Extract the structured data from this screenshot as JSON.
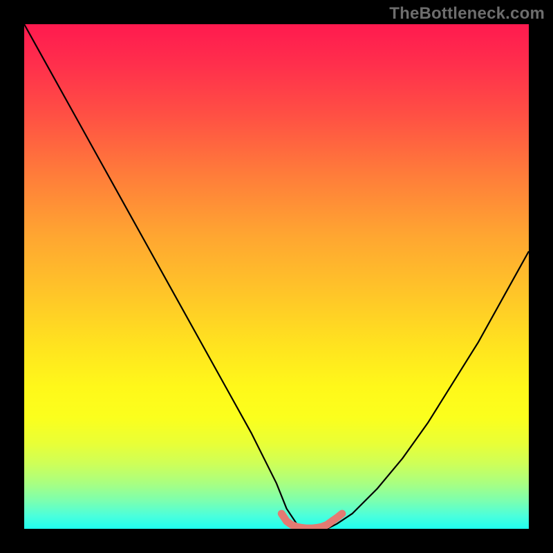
{
  "watermark": "TheBottleneck.com",
  "colors": {
    "frame": "#000000",
    "curve": "#000000",
    "highlight": "#e37a72",
    "gradient_stops": [
      "#ff1a4f",
      "#ff2f4c",
      "#ff5044",
      "#ff7d3a",
      "#ffa631",
      "#ffc728",
      "#ffe41f",
      "#fff81a",
      "#fbff1d",
      "#e9ff36",
      "#cfff57",
      "#a9ff81",
      "#7bffb0",
      "#4affdc",
      "#1fffef"
    ]
  },
  "chart_data": {
    "type": "line",
    "title": "",
    "xlabel": "",
    "ylabel": "",
    "xlim": [
      0,
      100
    ],
    "ylim": [
      0,
      100
    ],
    "annotations": [],
    "series": [
      {
        "name": "curve",
        "x": [
          0,
          5,
          10,
          15,
          20,
          25,
          30,
          35,
          40,
          45,
          50,
          52,
          54,
          56,
          58,
          60,
          62,
          65,
          70,
          75,
          80,
          85,
          90,
          95,
          100
        ],
        "y": [
          100,
          91,
          82,
          73,
          64,
          55,
          46,
          37,
          28,
          19,
          9,
          4,
          1,
          0,
          0,
          0,
          1,
          3,
          8,
          14,
          21,
          29,
          37,
          46,
          55
        ]
      },
      {
        "name": "floor-highlight",
        "x": [
          51,
          52,
          53,
          54,
          55,
          56,
          57,
          58,
          59,
          60,
          61,
          62,
          63
        ],
        "y": [
          3,
          1.5,
          0.8,
          0.4,
          0.2,
          0.1,
          0.1,
          0.2,
          0.4,
          0.8,
          1.5,
          2.2,
          3
        ]
      }
    ]
  }
}
